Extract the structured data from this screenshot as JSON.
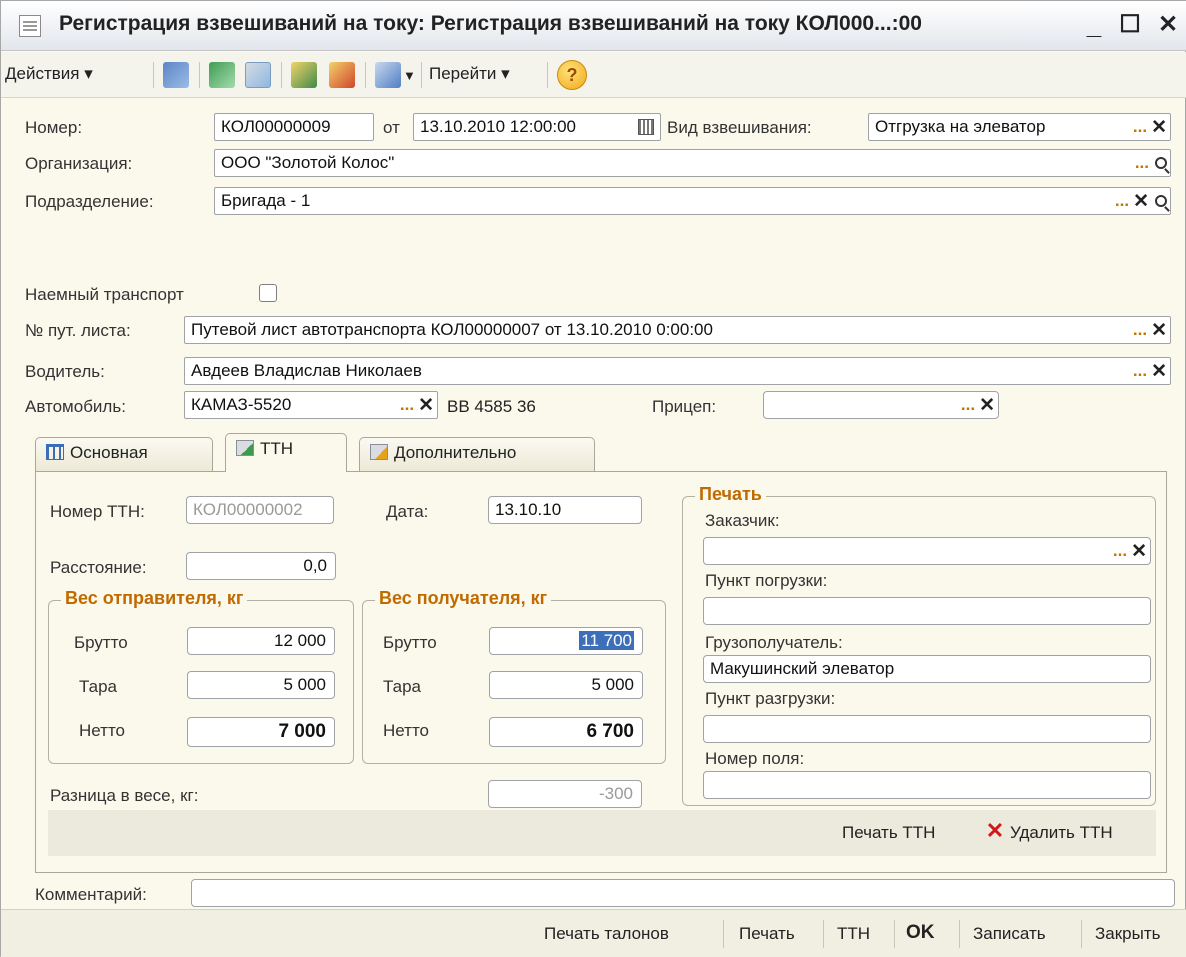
{
  "window": {
    "title": "Регистрация взвешиваний на току: Регистрация взвешиваний на току КОЛ000...:00",
    "minimize": "_",
    "maximize": "☐",
    "close": "✕"
  },
  "toolbar": {
    "actions": "Действия ▾",
    "goto": "Перейти ▾",
    "help": "?"
  },
  "header": {
    "number_label": "Номер:",
    "number_value": "КОЛ00000009",
    "from_label": "от",
    "date_value": "13.10.2010 12:00:00",
    "weigh_type_label": "Вид взвешивания:",
    "weigh_type_value": "Отгрузка на элеватор",
    "org_label": "Организация:",
    "org_value": "ООО \"Золотой Колос\"",
    "division_label": "Подразделение:",
    "division_value": "Бригада - 1"
  },
  "transport": {
    "hired_label": "Наемный транспорт",
    "waybill_label": "№ пут. листа:",
    "waybill_value": "Путевой лист автотранспорта КОЛ00000007 от 13.10.2010 0:00:00",
    "driver_label": "Водитель:",
    "driver_value": "Авдеев Владислав Николаев",
    "car_label": "Автомобиль:",
    "car_value": "КАМАЗ-5520",
    "plate": "ВВ 4585 36",
    "trailer_label": "Прицеп:",
    "trailer_value": ""
  },
  "tabs": [
    {
      "label": "Основная"
    },
    {
      "label": "ТТН"
    },
    {
      "label": "Дополнительно"
    }
  ],
  "ttn": {
    "number_label": "Номер ТТН:",
    "number_value": "КОЛ00000002",
    "date_label": "Дата:",
    "date_value": "13.10.10",
    "distance_label": "Расстояние:",
    "distance_value": "0,0",
    "sender_title": "Вес отправителя, кг",
    "receiver_title": "Вес получателя, кг",
    "gross_label": "Брутто",
    "tare_label": "Тара",
    "net_label": "Нетто",
    "sender_gross": "12 000",
    "sender_tare": "5 000",
    "sender_net": "7 000",
    "receiver_gross": "11 700",
    "receiver_tare": "5 000",
    "receiver_net": "6 700",
    "diff_label": "Разница в весе, кг:",
    "diff_value": "-300"
  },
  "print": {
    "title": "Печать",
    "customer_label": "Заказчик:",
    "customer_value": "",
    "load_point_label": "Пункт погрузки:",
    "load_point_value": "",
    "consignee_label": "Грузополучатель:",
    "consignee_value": "Макушинский элеватор",
    "unload_point_label": "Пункт разгрузки:",
    "unload_point_value": "",
    "field_number_label": "Номер поля:",
    "field_number_value": ""
  },
  "panel_actions": {
    "print_ttn": "Печать ТТН",
    "delete_ttn": "Удалить ТТН"
  },
  "comment": {
    "label": "Комментарий:",
    "value": ""
  },
  "bottom": {
    "print_tickets": "Печать талонов",
    "print": "Печать",
    "ttn": "ТТН",
    "ok": "OK",
    "save": "Записать",
    "close": "Закрыть"
  }
}
